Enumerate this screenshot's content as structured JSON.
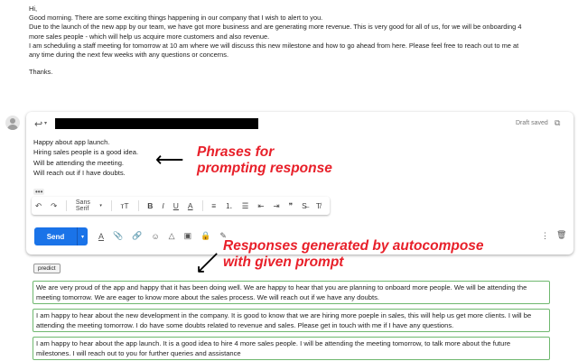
{
  "original_email": {
    "lines": [
      "Hi,",
      "Good morning. There are some exciting things happening in our company that I wish to alert to you.",
      "Due to the launch of the new app by our team, we have got more business and are generating more revenue. This is very good for all of us, for we will be onboarding 4",
      "more sales people - which will help us acquire more customers and also revenue.",
      "I am scheduling a staff meeting for tomorrow at 10 am where we will discuss this new milestone and how to go ahead from here. Please feel free to reach out to me at",
      "any time during the next few weeks with any questions or concerns."
    ],
    "signoff": "Thanks."
  },
  "compose": {
    "draft_status": "Draft saved",
    "draft_lines": [
      "Happy about app launch.",
      "Hiring sales people is a good idea.",
      "Will be attending the meeting.",
      "Will reach out if I have doubts."
    ],
    "ellipsis": "•••",
    "font_name": "Sans Serif",
    "send_label": "Send"
  },
  "icons": {
    "reply": "↩",
    "dropdown": "▾",
    "popout": "⧉",
    "undo": "↶",
    "redo": "↷",
    "text_size": "ᴛT",
    "bold": "B",
    "italic": "I",
    "underline": "U",
    "text_color": "A",
    "align": "≡",
    "numbered_list": "⒈",
    "bulleted_list": "☰",
    "indent_less": "⇤",
    "indent_more": "⇥",
    "quote": "❞",
    "strikethrough": "S̶",
    "clear_format": "T̸",
    "format_toggle": "A",
    "attach": "📎",
    "link": "🔗",
    "emoji": "☺",
    "drive": "△",
    "photo": "▣",
    "lock": "🔒",
    "signature": "✎",
    "more_vert": "⋮",
    "trash": "🗑"
  },
  "annotations": {
    "prompt_label_line1": "Phrases for",
    "prompt_label_line2": "prompting response",
    "responses_label_line1": "Responses generated by autocompose",
    "responses_label_line2": "with given prompt"
  },
  "predict_label": "predict",
  "responses": [
    "We are very proud of the app and happy that it has been doing well. We are happy to hear that you are planning to onboard more people. We will be attending the meeting tomorrow. We are eager to know more about the sales process. We will reach out if we have any doubts.",
    "I am happy to hear about the new development in the company. It is good to know that we are hiring more poeple in sales, this will help us get more clients. I will be attending the meeting tomorrow. I do have some doubts related to revenue and sales. Please get in touch with me if I have any questions.",
    "I am happy to hear about the app launch. It is a good idea to hire 4 more sales people. I will be attending the meeting tomorrow, to talk more about the future milestones. I will reach out to you for further queries and assistance"
  ],
  "colors": {
    "annotation_red": "#e8202a",
    "send_blue": "#1a73e8",
    "response_border_green": "#6fb86f"
  }
}
